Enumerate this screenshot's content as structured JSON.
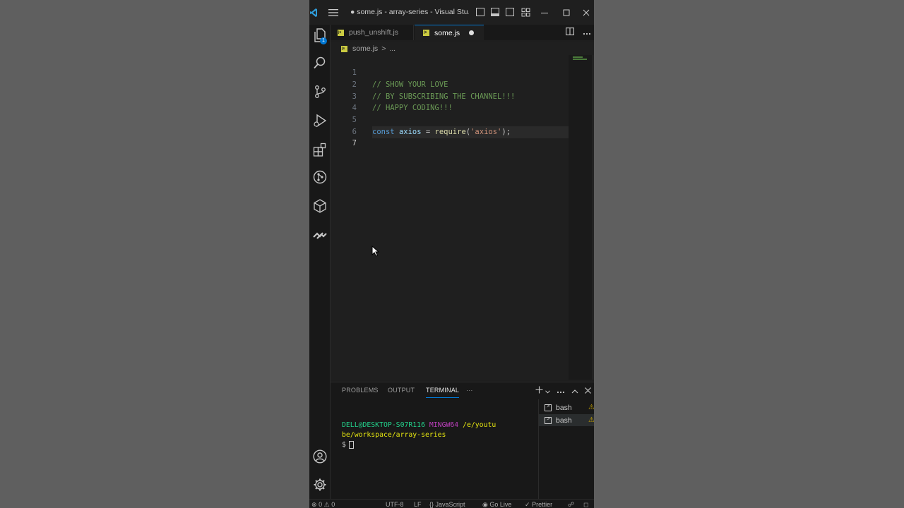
{
  "window": {
    "title": "● some.js - array-series - Visual Stu..."
  },
  "activity_bar": {
    "items": [
      "files-icon",
      "search-icon",
      "source-control-icon",
      "run-debug-icon",
      "extensions-icon",
      "git-graph-icon",
      "remote-box-icon",
      "live-share-icon"
    ],
    "explorer_badge": "1",
    "bottom": [
      "account-icon",
      "settings-gear-icon"
    ]
  },
  "tabs": [
    {
      "label": "push_unshift.js",
      "active": false,
      "dirty": false
    },
    {
      "label": "some.js",
      "active": true,
      "dirty": true
    }
  ],
  "breadcrumb": {
    "file": "some.js",
    "separator": ">",
    "rest": "..."
  },
  "editor": {
    "lines": [
      {
        "num": "1",
        "text": "// SHOW YOUR LOVE"
      },
      {
        "num": "2",
        "text": "// BY SUBSCRIBING THE CHANNEL!!!"
      },
      {
        "num": "3",
        "text": "// HAPPY CODING!!!"
      },
      {
        "num": "4",
        "text": ""
      },
      {
        "num": "5",
        "kw": "const",
        "var": "axios",
        "op": " = ",
        "fn": "require",
        "open": "(",
        "str": "'axios'",
        "close": ");"
      },
      {
        "num": "6",
        "text": ""
      },
      {
        "num": "7",
        "text": ""
      }
    ],
    "active_line": "7"
  },
  "panel": {
    "tabs": [
      "PROBLEMS",
      "OUTPUT",
      "TERMINAL",
      "···"
    ],
    "active_tab": "TERMINAL",
    "terminal": {
      "user": "DELL@DESKTOP-S07R116",
      "host": "MINGW64",
      "path_line1": "/e/youtu",
      "path_line2": "be/workspace/array-series",
      "prompt": "$"
    },
    "terminals": [
      {
        "label": "bash",
        "selected": false
      },
      {
        "label": "bash",
        "selected": true
      }
    ]
  },
  "status_bar": {
    "errors": "0",
    "warnings": "0",
    "encoding": "UTF-8",
    "eol": "LF",
    "language": "JavaScript",
    "go_live": "Go Live",
    "prettier": "Prettier"
  },
  "colors": {
    "comment": "#6a9955",
    "keyword": "#569cd6",
    "string": "#ce9178",
    "accent": "#0078d4"
  }
}
